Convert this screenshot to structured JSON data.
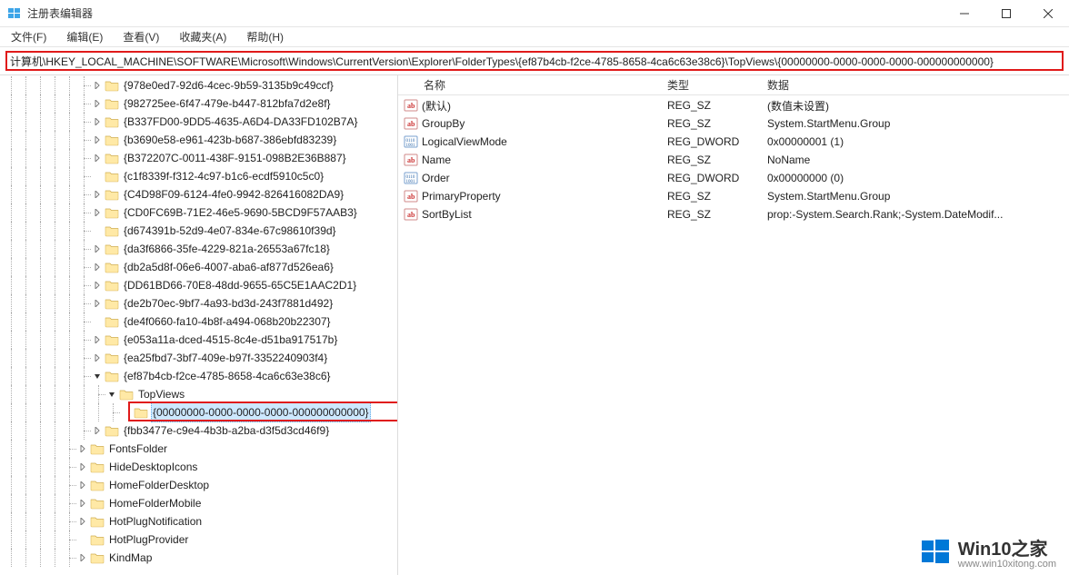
{
  "window": {
    "title": "注册表编辑器"
  },
  "menu": {
    "file": "文件(F)",
    "edit": "编辑(E)",
    "view": "查看(V)",
    "favorites": "收藏夹(A)",
    "help": "帮助(H)"
  },
  "address": "计算机\\HKEY_LOCAL_MACHINE\\SOFTWARE\\Microsoft\\Windows\\CurrentVersion\\Explorer\\FolderTypes\\{ef87b4cb-f2ce-4785-8658-4ca6c63e38c6}\\TopViews\\{00000000-0000-0000-0000-000000000000}",
  "tree": [
    {
      "indent": 6,
      "chev": "right",
      "label": "{978e0ed7-92d6-4cec-9b59-3135b9c49ccf}"
    },
    {
      "indent": 6,
      "chev": "right",
      "label": "{982725ee-6f47-479e-b447-812bfa7d2e8f}"
    },
    {
      "indent": 6,
      "chev": "right",
      "label": "{B337FD00-9DD5-4635-A6D4-DA33FD102B7A}"
    },
    {
      "indent": 6,
      "chev": "right",
      "label": "{b3690e58-e961-423b-b687-386ebfd83239}"
    },
    {
      "indent": 6,
      "chev": "right",
      "label": "{B372207C-0011-438F-9151-098B2E36B887}"
    },
    {
      "indent": 6,
      "chev": "none",
      "label": "{c1f8339f-f312-4c97-b1c6-ecdf5910c5c0}"
    },
    {
      "indent": 6,
      "chev": "right",
      "label": "{C4D98F09-6124-4fe0-9942-826416082DA9}"
    },
    {
      "indent": 6,
      "chev": "right",
      "label": "{CD0FC69B-71E2-46e5-9690-5BCD9F57AAB3}"
    },
    {
      "indent": 6,
      "chev": "none",
      "label": "{d674391b-52d9-4e07-834e-67c98610f39d}"
    },
    {
      "indent": 6,
      "chev": "right",
      "label": "{da3f6866-35fe-4229-821a-26553a67fc18}"
    },
    {
      "indent": 6,
      "chev": "right",
      "label": "{db2a5d8f-06e6-4007-aba6-af877d526ea6}"
    },
    {
      "indent": 6,
      "chev": "right",
      "label": "{DD61BD66-70E8-48dd-9655-65C5E1AAC2D1}"
    },
    {
      "indent": 6,
      "chev": "right",
      "label": "{de2b70ec-9bf7-4a93-bd3d-243f7881d492}"
    },
    {
      "indent": 6,
      "chev": "none",
      "label": "{de4f0660-fa10-4b8f-a494-068b20b22307}"
    },
    {
      "indent": 6,
      "chev": "right",
      "label": "{e053a11a-dced-4515-8c4e-d51ba917517b}"
    },
    {
      "indent": 6,
      "chev": "right",
      "label": "{ea25fbd7-3bf7-409e-b97f-3352240903f4}"
    },
    {
      "indent": 6,
      "chev": "down",
      "label": "{ef87b4cb-f2ce-4785-8658-4ca6c63e38c6}"
    },
    {
      "indent": 7,
      "chev": "down",
      "label": "TopViews"
    },
    {
      "indent": 8,
      "chev": "none",
      "label": "{00000000-0000-0000-0000-000000000000}",
      "selected": true
    },
    {
      "indent": 6,
      "chev": "right",
      "label": "{fbb3477e-c9e4-4b3b-a2ba-d3f5d3cd46f9}"
    },
    {
      "indent": 5,
      "chev": "right",
      "label": "FontsFolder"
    },
    {
      "indent": 5,
      "chev": "right",
      "label": "HideDesktopIcons"
    },
    {
      "indent": 5,
      "chev": "right",
      "label": "HomeFolderDesktop"
    },
    {
      "indent": 5,
      "chev": "right",
      "label": "HomeFolderMobile"
    },
    {
      "indent": 5,
      "chev": "right",
      "label": "HotPlugNotification"
    },
    {
      "indent": 5,
      "chev": "none",
      "label": "HotPlugProvider"
    },
    {
      "indent": 5,
      "chev": "right",
      "label": "KindMap"
    }
  ],
  "list": {
    "headers": {
      "name": "名称",
      "type": "类型",
      "data": "数据"
    },
    "rows": [
      {
        "icon": "str",
        "name": "(默认)",
        "type": "REG_SZ",
        "data": "(数值未设置)"
      },
      {
        "icon": "str",
        "name": "GroupBy",
        "type": "REG_SZ",
        "data": "System.StartMenu.Group"
      },
      {
        "icon": "bin",
        "name": "LogicalViewMode",
        "type": "REG_DWORD",
        "data": "0x00000001 (1)"
      },
      {
        "icon": "str",
        "name": "Name",
        "type": "REG_SZ",
        "data": "NoName"
      },
      {
        "icon": "bin",
        "name": "Order",
        "type": "REG_DWORD",
        "data": "0x00000000 (0)"
      },
      {
        "icon": "str",
        "name": "PrimaryProperty",
        "type": "REG_SZ",
        "data": "System.StartMenu.Group"
      },
      {
        "icon": "str",
        "name": "SortByList",
        "type": "REG_SZ",
        "data": "prop:-System.Search.Rank;-System.DateModif..."
      }
    ]
  },
  "watermark": {
    "main": "Win10之家",
    "sub": "www.win10xitong.com"
  }
}
